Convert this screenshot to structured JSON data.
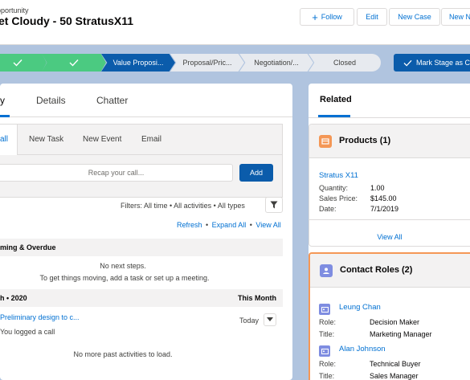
{
  "header": {
    "object_type": "pportunity",
    "record_title": "et Cloudy - 50 StratusX11",
    "buttons": {
      "follow": "Follow",
      "edit": "Edit",
      "new_case": "New Case",
      "new_more": "New N"
    }
  },
  "path": {
    "stages": [
      {
        "label": "",
        "state": "complete"
      },
      {
        "label": "",
        "state": "complete"
      },
      {
        "label": "Value Proposi...",
        "state": "current"
      },
      {
        "label": "Proposal/Pric...",
        "state": "incomplete"
      },
      {
        "label": "Negotiation/...",
        "state": "incomplete"
      },
      {
        "label": "Closed",
        "state": "incomplete"
      }
    ],
    "mark_stage_label": "Mark Stage as C"
  },
  "left_tabs": {
    "active_fragment": "y",
    "details": "Details",
    "chatter": "Chatter"
  },
  "composer": {
    "tabs": {
      "call_fragment": "all",
      "new_task": "New Task",
      "new_event": "New Event",
      "email": "Email"
    },
    "recap_placeholder": "Recap your call...",
    "add_label": "Add"
  },
  "activity": {
    "filters_text": "Filters: All time • All activities • All types",
    "refresh": "Refresh",
    "expand_all": "Expand All",
    "view_all": "View All",
    "upcoming_header": "ming & Overdue",
    "no_next_steps": "No next steps.",
    "get_moving": "To get things moving, add a task or set up a meeting.",
    "month_header": "h • 2020",
    "this_month": "This Month",
    "item_title": "Preliminary design to c...",
    "item_sub": "You logged a call",
    "item_date": "Today",
    "no_more": "No more past activities to load."
  },
  "related": {
    "title": "Related",
    "products": {
      "title": "Products (1)",
      "product_name": "Stratus X11",
      "quantity_label": "Quantity:",
      "quantity_value": "1.00",
      "sales_price_label": "Sales Price:",
      "sales_price_value": "$145.00",
      "date_label": "Date:",
      "date_value": "7/1/2019",
      "view_all": "View All"
    },
    "contact_roles": {
      "title": "Contact Roles (2)",
      "contacts": [
        {
          "name": "Leung Chan",
          "role_label": "Role:",
          "role": "Decision Maker",
          "title_label": "Title:",
          "title": "Marketing Manager"
        },
        {
          "name": "Alan Johnson",
          "role_label": "Role:",
          "role": "Technical Buyer",
          "title_label": "Title:",
          "title": "Sales Manager"
        }
      ]
    }
  },
  "colors": {
    "brand": "#0b5cab",
    "link": "#0070d2",
    "complete": "#4bca81",
    "highlight": "#f49756",
    "background": "#b0c4df"
  }
}
